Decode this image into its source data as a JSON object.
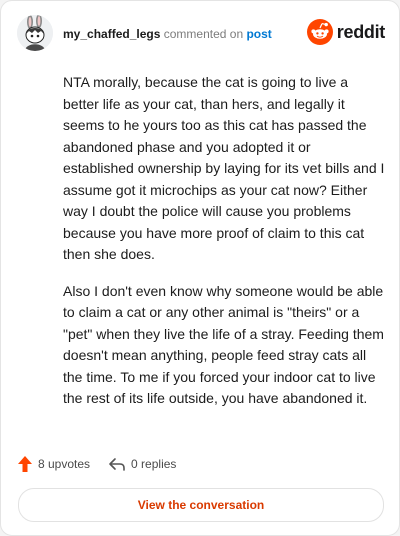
{
  "header": {
    "username": "my_chaffed_legs",
    "action_text": "commented on",
    "post_link": "post",
    "brand": "reddit"
  },
  "comment": {
    "paragraphs": [
      "NTA morally, because the cat is going to live a better life as your cat, than hers, and legally it seems to he yours too as this cat has passed the abandoned phase and you adopted it or established ownership by laying for its vet bills and I assume got it microchips as your cat now? Either way I doubt the police will cause you problems because you have more proof of claim to this cat then she does.",
      "Also I don't even know why someone would be able to claim a cat or any other animal is \"theirs\" or a \"pet\" when they live the life of a stray. Feeding them doesn't mean anything, people feed stray cats all the time. To me if you forced your indoor cat to live the rest of its life outside, you have abandoned it."
    ]
  },
  "footer": {
    "upvotes": "8 upvotes",
    "replies": "0 replies"
  },
  "cta": {
    "label": "View the conversation"
  },
  "colors": {
    "brand": "#ff4500",
    "link": "#0079d3",
    "cta_text": "#d93a00"
  },
  "icons": {
    "avatar": "snoo-avatar",
    "brand": "reddit-logo-icon",
    "upvote": "upvote-arrow-icon",
    "reply": "reply-arrow-icon"
  }
}
